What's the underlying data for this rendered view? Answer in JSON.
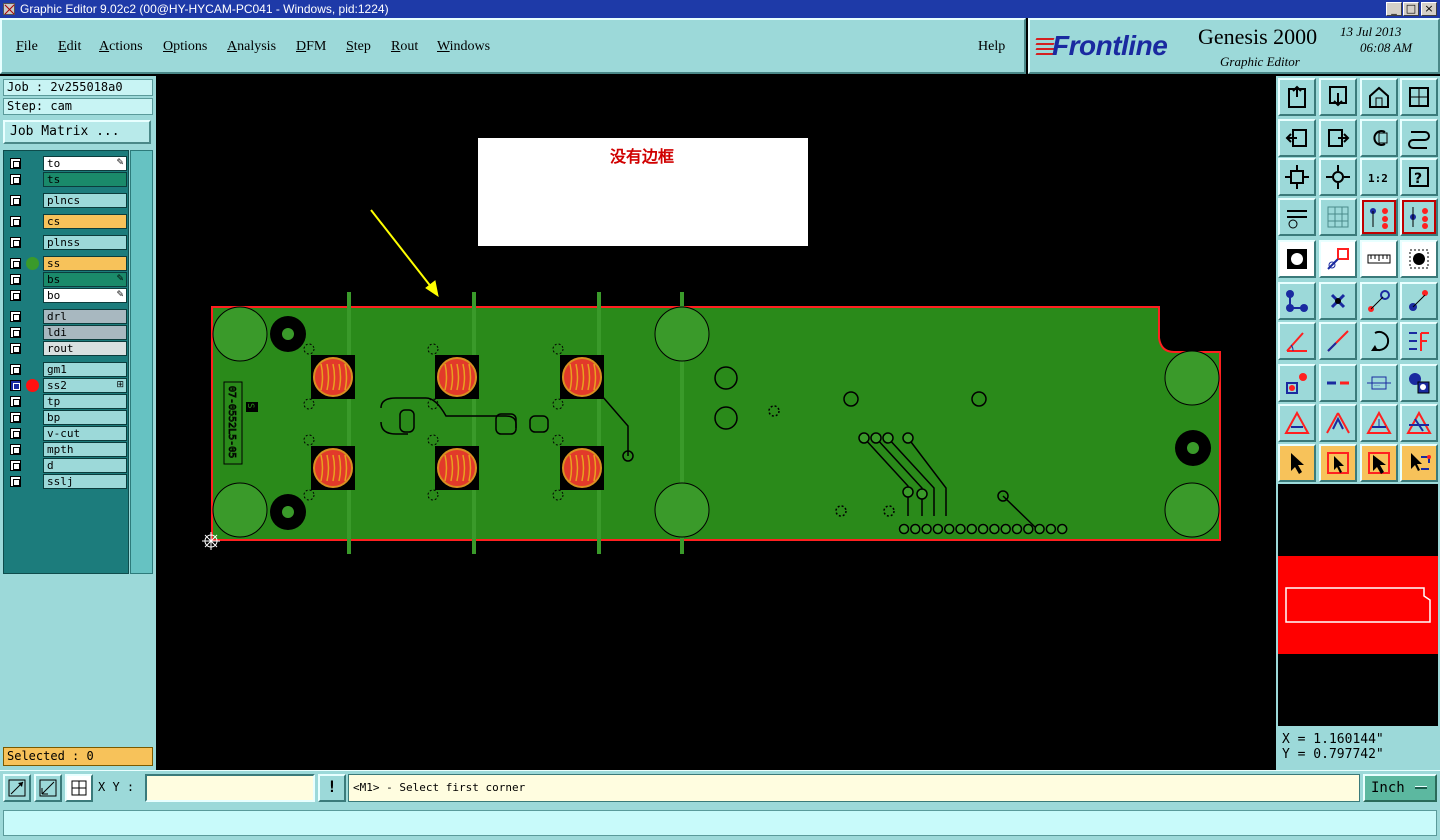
{
  "window": {
    "title": "Graphic Editor 9.02c2 (00@HY-HYCAM-PC041 - Windows, pid:1224)"
  },
  "menu": {
    "items": [
      "File",
      "Edit",
      "Actions",
      "Options",
      "Analysis",
      "DFM",
      "Step",
      "Rout",
      "Windows"
    ],
    "help": "Help"
  },
  "logo": {
    "brand": "Frontline",
    "product": "Genesis 2000",
    "date": "13 Jul 2013",
    "time": "06:08 AM",
    "subtitle": "Graphic Editor"
  },
  "job": {
    "job_label": "Job : 2v255018a0",
    "step_label": "Step: cam",
    "matrix_button": "Job Matrix ..."
  },
  "layers": [
    {
      "name": "to",
      "color": "#ffffff",
      "marker": "pencil"
    },
    {
      "name": "ts",
      "color": "#1a8a6a"
    },
    {
      "name": "plncs",
      "color": "#9cd9d9"
    },
    {
      "name": "cs",
      "color": "#f7c25a"
    },
    {
      "name": "plnss",
      "color": "#9cd9d9"
    },
    {
      "name": "ss",
      "color": "#f7c25a",
      "dot": "#3a9a2a"
    },
    {
      "name": "bs",
      "color": "#1a8a6a",
      "marker": "pencil"
    },
    {
      "name": "bo",
      "color": "#ffffff",
      "marker": "pencil"
    },
    {
      "name": "drl",
      "color": "#a8b8c0"
    },
    {
      "name": "ldi",
      "color": "#a8b8c0"
    },
    {
      "name": "rout",
      "color": "#d8e0e0"
    },
    {
      "name": "gm1",
      "color": "#9cd9d9"
    },
    {
      "name": "ss2",
      "color": "#9cd9d9",
      "dot": "#ff1010",
      "active": true,
      "marker": "grid"
    },
    {
      "name": "tp",
      "color": "#9cd9d9"
    },
    {
      "name": "bp",
      "color": "#9cd9d9"
    },
    {
      "name": "v-cut",
      "color": "#9cd9d9"
    },
    {
      "name": "mpth",
      "color": "#9cd9d9"
    },
    {
      "name": "d",
      "color": "#9cd9d9"
    },
    {
      "name": "sslj",
      "color": "#9cd9d9"
    }
  ],
  "status": {
    "selected": "Selected : 0"
  },
  "annotation": {
    "text": "没有边框",
    "arrow_color": "#ffff00",
    "text_color": "#d00000"
  },
  "board": {
    "fill": "#2a8a1a",
    "outline": "#ff2020",
    "silk_text": "07-0552L5-05",
    "silk_small": "S"
  },
  "coords": {
    "x": "X = 1.160144\"",
    "y": "Y = 0.797742\""
  },
  "bottom": {
    "xy_label": "X Y :",
    "xy_value": "",
    "warn": "!",
    "prompt": "<M1> - Select first corner",
    "unit": "Inch"
  },
  "tools": [
    "fit-screen-icon",
    "redraw-icon",
    "home-icon",
    "split-view-icon",
    "pan-left-icon",
    "pan-right-icon",
    "undo-zoom-icon",
    "zoom-swap-icon",
    "zoom-fit-icon",
    "zoom-center-icon",
    "scale-1-2-icon",
    "help-icon",
    "tools-icon",
    "grid-icon",
    "layer-compare-icon",
    "layer-compare-alt-icon",
    "pad-select-icon",
    "measure-icon",
    "ruler-icon",
    "drill-icon",
    "connect-icon",
    "delete-node-icon",
    "snap-point-icon",
    "snap-alt-icon",
    "draw-line-icon",
    "draw-arc-icon",
    "rotate-icon",
    "mirror-icon",
    "move-feature-icon",
    "line-break-icon",
    "align-icon",
    "copy-shape-icon",
    "triangle-a-icon",
    "triangle-b-icon",
    "triangle-c-icon",
    "triangle-d-icon",
    "pointer-icon",
    "pointer-box-icon",
    "pointer-area-icon",
    "pointer-net-icon"
  ]
}
